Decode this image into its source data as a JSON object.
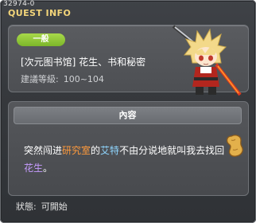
{
  "window": {
    "quest_id": "32974-0",
    "title": "QUEST INFO"
  },
  "quest": {
    "category": "一般",
    "name": "[次元图书馆] 花生、书和秘密",
    "level_label": "建議等級:",
    "level_range": "100~104"
  },
  "content": {
    "header": "內容",
    "text_part1": "突然闯进",
    "highlight_location": "研究室",
    "text_part2": "的",
    "highlight_npc": "艾特",
    "text_part3": "不由分说地就叫我去找回",
    "highlight_item": "花生",
    "text_part4": "。"
  },
  "status": {
    "label": "狀態:",
    "value": "可開始"
  },
  "icons": {
    "npc": "npc-swordsman-portrait",
    "item": "peanut-icon"
  },
  "colors": {
    "title": "#f3d57a",
    "badge": "#8dc73a",
    "location_highlight": "#ff9a3c",
    "npc_highlight": "#8fd6ff",
    "item_highlight": "#c79cff"
  }
}
